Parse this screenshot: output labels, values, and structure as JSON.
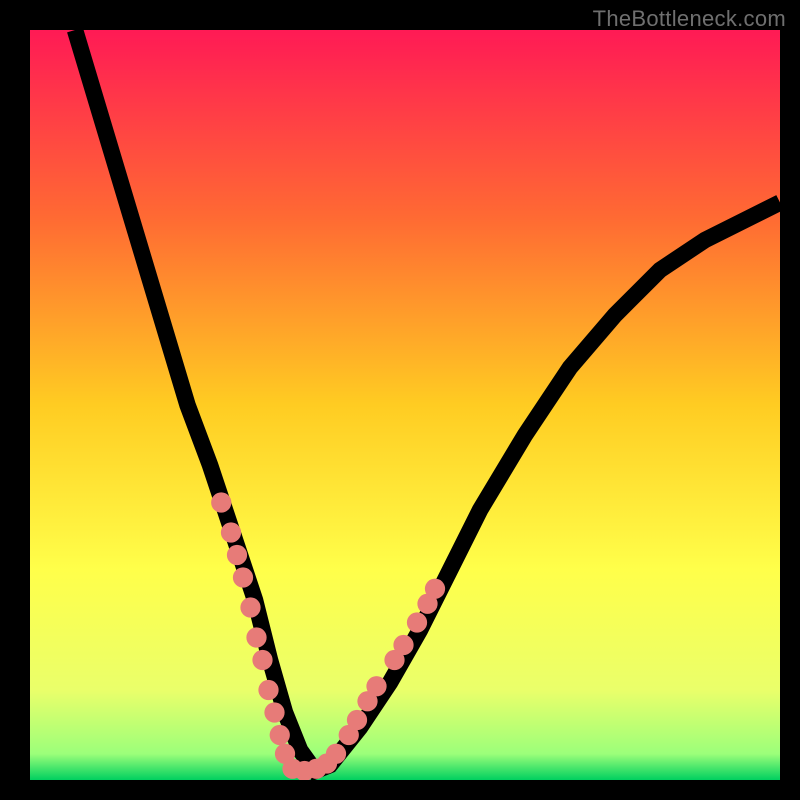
{
  "watermark": "TheBottleneck.com",
  "chart_data": {
    "type": "line",
    "title": "",
    "xlabel": "",
    "ylabel": "",
    "xlim": [
      0,
      100
    ],
    "ylim": [
      0,
      100
    ],
    "grid": false,
    "legend": false,
    "background_gradient": {
      "stops": [
        {
          "offset": 0.0,
          "color": "#ff1a55"
        },
        {
          "offset": 0.25,
          "color": "#ff6a33"
        },
        {
          "offset": 0.5,
          "color": "#ffcc22"
        },
        {
          "offset": 0.72,
          "color": "#ffff4a"
        },
        {
          "offset": 0.88,
          "color": "#eaff6a"
        },
        {
          "offset": 0.965,
          "color": "#9cff7a"
        },
        {
          "offset": 1.0,
          "color": "#00d060"
        }
      ]
    },
    "series": [
      {
        "name": "bottleneck-curve",
        "x": [
          6,
          9,
          12,
          15,
          18,
          21,
          24,
          27,
          30,
          32,
          34,
          36,
          38,
          40,
          44,
          48,
          52,
          56,
          60,
          66,
          72,
          78,
          84,
          90,
          96,
          100
        ],
        "y_pct": [
          100,
          90,
          80,
          70,
          60,
          50,
          42,
          33,
          24,
          16,
          9,
          4,
          1.2,
          2,
          7,
          13,
          20,
          28,
          36,
          46,
          55,
          62,
          68,
          72,
          75,
          77
        ]
      }
    ],
    "markers": {
      "name": "highlighted-points",
      "color": "#e77b78",
      "points": [
        {
          "x": 25.5,
          "y_pct": 37
        },
        {
          "x": 26.8,
          "y_pct": 33
        },
        {
          "x": 27.6,
          "y_pct": 30
        },
        {
          "x": 28.4,
          "y_pct": 27
        },
        {
          "x": 29.4,
          "y_pct": 23
        },
        {
          "x": 30.2,
          "y_pct": 19
        },
        {
          "x": 31.0,
          "y_pct": 16
        },
        {
          "x": 31.8,
          "y_pct": 12
        },
        {
          "x": 32.6,
          "y_pct": 9
        },
        {
          "x": 33.3,
          "y_pct": 6
        },
        {
          "x": 34.0,
          "y_pct": 3.5
        },
        {
          "x": 35.0,
          "y_pct": 1.5
        },
        {
          "x": 36.6,
          "y_pct": 1.2
        },
        {
          "x": 38.2,
          "y_pct": 1.5
        },
        {
          "x": 39.6,
          "y_pct": 2.2
        },
        {
          "x": 40.8,
          "y_pct": 3.5
        },
        {
          "x": 42.5,
          "y_pct": 6
        },
        {
          "x": 43.6,
          "y_pct": 8
        },
        {
          "x": 45.0,
          "y_pct": 10.5
        },
        {
          "x": 46.2,
          "y_pct": 12.5
        },
        {
          "x": 48.6,
          "y_pct": 16
        },
        {
          "x": 49.8,
          "y_pct": 18
        },
        {
          "x": 51.6,
          "y_pct": 21
        },
        {
          "x": 53.0,
          "y_pct": 23.5
        },
        {
          "x": 54.0,
          "y_pct": 25.5
        }
      ]
    }
  }
}
